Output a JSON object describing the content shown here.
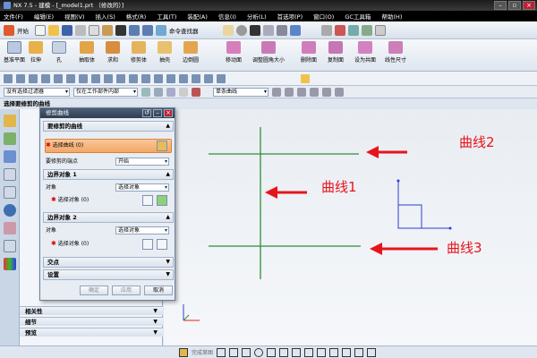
{
  "window": {
    "title": "NX 7.5 - 建模 - [_model1.prt （修改的）]"
  },
  "menu": [
    "文件(F)",
    "编辑(E)",
    "视图(V)",
    "插入(S)",
    "格式(R)",
    "工具(T)",
    "装配(A)",
    "信息(I)",
    "分析(L)",
    "首选项(P)",
    "窗口(O)",
    "GC工具箱",
    "帮助(H)"
  ],
  "toolbar": {
    "start_label": "开始",
    "command_finder_label": "命令查找器"
  },
  "ribbon": {
    "items": [
      "基准平面",
      "拉伸",
      "孔",
      "抽取体",
      "求和",
      "修剪体",
      "抽壳",
      "边倒圆",
      "移动面",
      "调整圆角大小",
      "删除面",
      "复制面",
      "设为共面",
      "线性尺寸"
    ]
  },
  "selection_bar": {
    "filter": "没有选择过滤器",
    "scope": "仅在工作部件内部",
    "curve_rule": "单条曲线"
  },
  "cue_line": "选择要修剪的曲线",
  "navigator": {
    "sections": [
      "相关性",
      "细节",
      "预览"
    ]
  },
  "dialog": {
    "title": "修剪曲线",
    "group1": {
      "title": "要修剪的曲线",
      "select_label": "选择曲线 (0)",
      "endpoint_label": "要修剪的端点",
      "endpoint_value": "开始"
    },
    "group2": {
      "title": "边界对象 1",
      "object_label": "对象",
      "object_value": "选择对象",
      "select_label": "选择对象 (0)"
    },
    "group3": {
      "title": "边界对象 2",
      "object_label": "对象",
      "object_value": "选择对象",
      "select_label": "选择对象 (0)"
    },
    "group4": {
      "title": "交点"
    },
    "group5": {
      "title": "设置"
    },
    "buttons": {
      "ok": "确定",
      "apply": "应用",
      "cancel": "取消"
    }
  },
  "annotations": {
    "curve1": "曲线1",
    "curve2": "曲线2",
    "curve3": "曲线3"
  },
  "bottom_bar": {
    "label": "完成草图"
  },
  "colors": {
    "curve": "#2f8f3a",
    "arrow": "#e8141c",
    "accent": "#f3a765"
  }
}
